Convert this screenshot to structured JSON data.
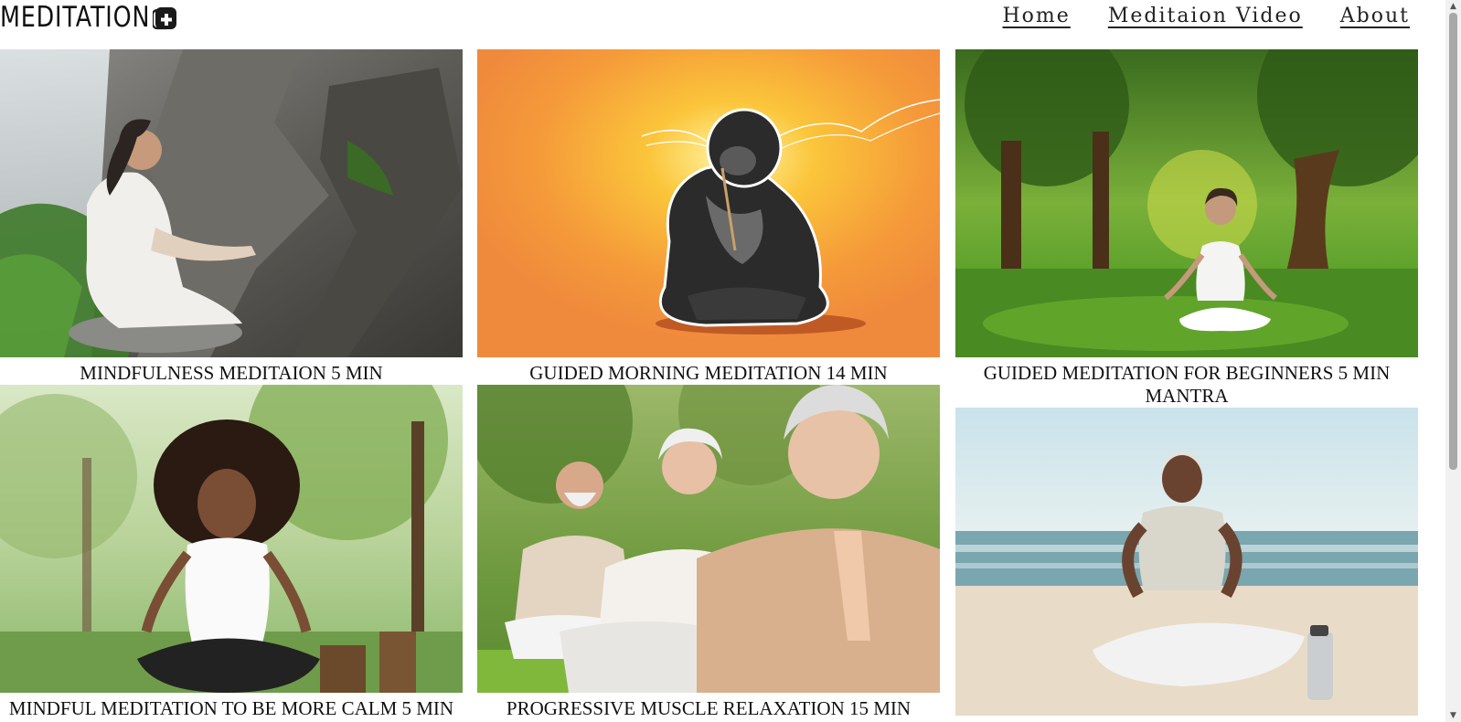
{
  "header": {
    "logo_text": "MEDITATION",
    "nav": [
      {
        "label": "Home"
      },
      {
        "label": "Meditaion Video"
      },
      {
        "label": "About"
      }
    ]
  },
  "videos": [
    {
      "title": "MINDFULNESS MEDITAION 5 MIN",
      "image": "man-meditating-by-waterfall"
    },
    {
      "title": "GUIDED MORNING MEDITATION 14 MIN",
      "image": "gorilla-meditating-cartoon"
    },
    {
      "title": "GUIDED MEDITATION FOR BEGINNERS 5 MIN MANTRA",
      "image": "woman-meditating-in-park"
    },
    {
      "title": "MINDFUL MEDITATION TO BE MORE CALM 5 MIN",
      "image": "girl-meditating-outdoors"
    },
    {
      "title": "PROGRESSIVE MUSCLE RELAXATION 15 MIN",
      "image": "seniors-meditating-in-park"
    },
    {
      "title": "",
      "image": "woman-meditating-on-beach"
    }
  ],
  "scrollbar": {
    "up_arrow": "▲",
    "down_arrow": "▼"
  }
}
